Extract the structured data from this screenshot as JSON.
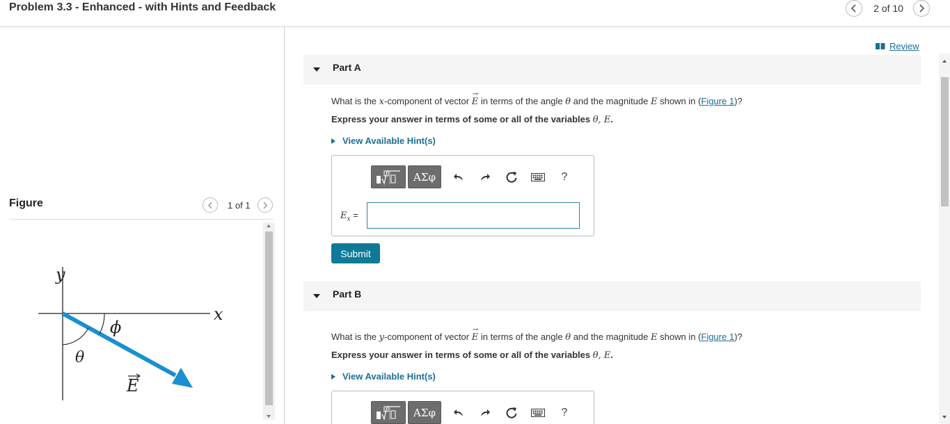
{
  "header": {
    "title": "Problem 3.3 - Enhanced - with Hints and Feedback",
    "counter": "2 of 10"
  },
  "review": {
    "label": "Review"
  },
  "figure": {
    "label": "Figure",
    "counter": "1 of 1",
    "labels": {
      "y": "y",
      "x": "x",
      "theta": "θ",
      "phi": "ϕ",
      "E": "E"
    },
    "colors": {
      "vector": "#1a8fd1",
      "axes": "#222"
    }
  },
  "parts": [
    {
      "label": "Part A",
      "question": {
        "pre": "What is the ",
        "var": "x",
        "mid1": "-component of vector ",
        "vec": "E",
        "mid2": " in terms of the angle ",
        "theta": "θ",
        "mid3": " and the magnitude ",
        "mag": "E",
        "mid4": " shown in (",
        "link": "Figure 1",
        "post": ")?"
      },
      "express": {
        "text": "Express your answer in terms of some or all of the variables ",
        "vars": "θ, E",
        "end": "."
      },
      "hint": "View Available Hint(s)",
      "toolbar": {
        "greek": "ΑΣφ",
        "help": "?"
      },
      "equation": {
        "var": "E",
        "sub": "x",
        "eq": " ="
      },
      "input_value": "",
      "submit": "Submit"
    },
    {
      "label": "Part B",
      "question": {
        "pre": "What is the ",
        "var": "y",
        "mid1": "-component of vector ",
        "vec": "E",
        "mid2": " in terms of the angle ",
        "theta": "θ",
        "mid3": " and the magnitude ",
        "mag": "E",
        "mid4": " shown in (",
        "link": "Figure 1",
        "post": ")?"
      },
      "express": {
        "text": "Express your answer in terms of some or all of the variables ",
        "vars": "θ, E",
        "end": "."
      },
      "hint": "View Available Hint(s)",
      "toolbar": {
        "greek": "ΑΣφ",
        "help": "?"
      }
    }
  ],
  "colors": {
    "accent": "#0f7a98",
    "link": "#1a6e96",
    "toolbar": "#6d6d6d"
  }
}
